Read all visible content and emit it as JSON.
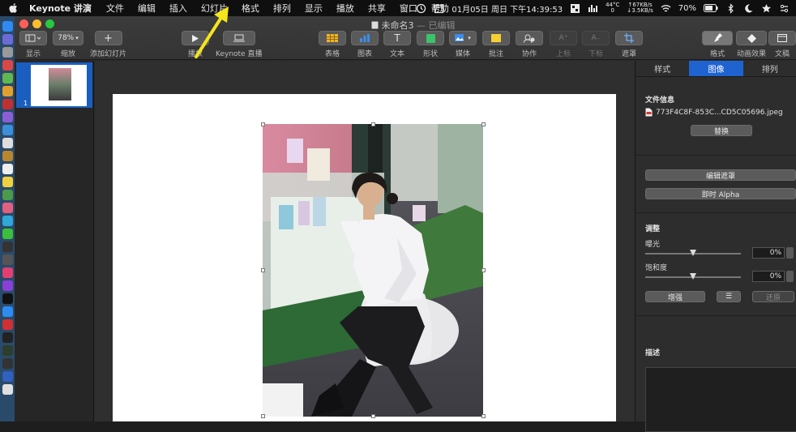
{
  "menubar": {
    "app_name": "Keynote 讲演",
    "items": [
      "文件",
      "编辑",
      "插入",
      "幻灯片",
      "格式",
      "排列",
      "显示",
      "播放",
      "共享",
      "窗口",
      "帮助"
    ],
    "datetime": "01月05日 周日 下午14:39:53",
    "temp": "44°C",
    "net_up": "↑67KB/s",
    "net_zero": "0",
    "net_down": "↓3.5KB/s",
    "battery": "70%"
  },
  "window": {
    "doc_name": "未命名3",
    "doc_status": "— 已编辑"
  },
  "toolbar": {
    "view_label": "显示",
    "zoom_value": "78%",
    "zoom_label": "缩放",
    "add_slide_label": "添加幻灯片",
    "play_label": "播放",
    "keynote_live_label": "Keynote 直播",
    "table_label": "表格",
    "chart_label": "图表",
    "text_label": "文本",
    "shape_label": "形状",
    "media_label": "媒体",
    "comment_label": "批注",
    "collaborate_label": "协作",
    "superscript_label": "上标",
    "subscript_label": "下标",
    "mask_label": "遮罩",
    "format_label": "格式",
    "animate_label": "动画效果",
    "document_label": "文稿"
  },
  "navigator": {
    "slide_number": "1"
  },
  "inspector": {
    "tabs": [
      "样式",
      "图像",
      "排列"
    ],
    "active_tab": "图像",
    "file_info_title": "文件信息",
    "file_name": "773F4C8F-853C...CD5C05696.jpeg",
    "replace_label": "替换",
    "edit_mask_label": "编辑遮罩",
    "instant_alpha_label": "即时 Alpha",
    "adjust_title": "调整",
    "exposure_label": "曝光",
    "exposure_value": "0%",
    "saturation_label": "饱和度",
    "saturation_value": "0%",
    "enhance_label": "增强",
    "reset_label": "还原",
    "description_title": "描述"
  },
  "colors": {
    "accent": "#1e63cf",
    "annotation_arrow": "#f5e51b"
  }
}
